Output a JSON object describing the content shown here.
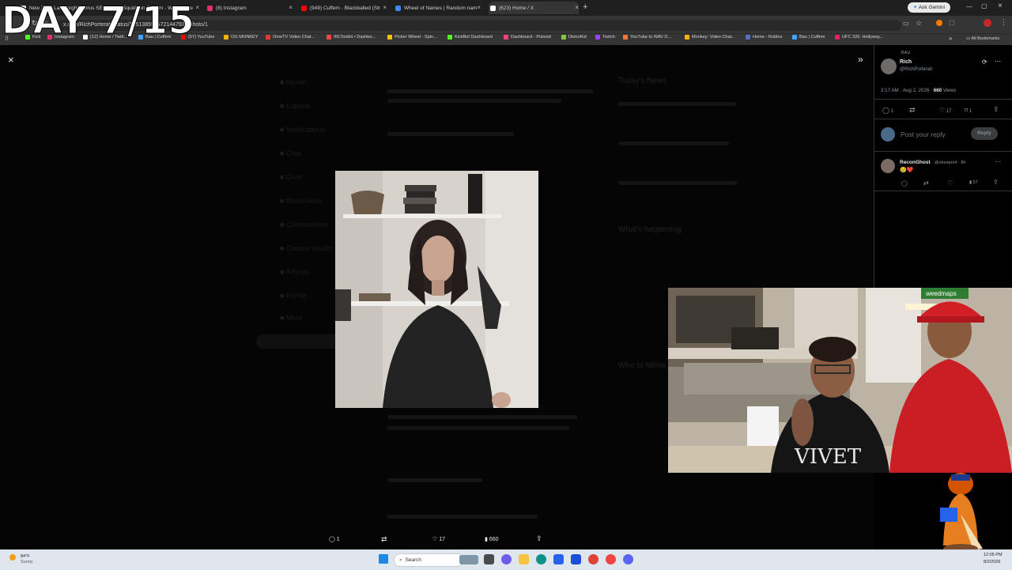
{
  "overlay": {
    "day_label": "DAY 7/15"
  },
  "tabs": [
    {
      "label": "New 2026 Lamborghini Urus SE",
      "color": "#e8e8e8"
    },
    {
      "label": "SquidRon Stream - Watch Live",
      "color": "#53fc18"
    },
    {
      "label": "(8) Instagram",
      "color": "#e1306c"
    },
    {
      "label": "(949) Cuffem - Blackballed (Str",
      "color": "#ff0000"
    },
    {
      "label": "Wheel of Names | Random nam",
      "color": "#4285f4"
    },
    {
      "label": "(623) Home / X",
      "color": "#ffffff"
    }
  ],
  "browser": {
    "url": "x.com/RichPorterati/status/1951385906721447936/photo/1",
    "ask_gemini": "Ask Gemini",
    "all_bookmarks": "All Bookmarks"
  },
  "bookmarks": [
    {
      "label": "Kick",
      "color": "#53fc18"
    },
    {
      "label": "Instagram",
      "color": "#e1306c"
    },
    {
      "label": "(12) Home / Twitt...",
      "color": "#ffffff"
    },
    {
      "label": "Bau | Cuffem",
      "color": "#3ea6ff"
    },
    {
      "label": "(57) YouTube",
      "color": "#ff0000"
    },
    {
      "label": "OG MONKEY",
      "color": "#f4b400"
    },
    {
      "label": "OmeTV Video Chat...",
      "color": "#e53935"
    },
    {
      "label": "IRLToolkit • Dashbo...",
      "color": "#ff4444"
    },
    {
      "label": "Picker Wheel - Spin...",
      "color": "#ffc107"
    },
    {
      "label": "KickBot Dashboard",
      "color": "#53fc18"
    },
    {
      "label": "Dashboard - Pulsoid",
      "color": "#ff4081"
    },
    {
      "label": "DistroKid",
      "color": "#8bc34a"
    },
    {
      "label": "Twitch",
      "color": "#9146ff"
    },
    {
      "label": "YouTube to WAV D...",
      "color": "#ff7043"
    },
    {
      "label": "Monkey: Video Chat...",
      "color": "#ffb300"
    },
    {
      "label": "Home - Roblox",
      "color": "#5c6bc0"
    },
    {
      "label": "Bau | Cuffem",
      "color": "#3ea6ff"
    },
    {
      "label": "UFC 326: Hollyway...",
      "color": "#e91e63"
    }
  ],
  "post_actions": {
    "replies": "1",
    "likes": "17",
    "views": "660"
  },
  "tweet": {
    "context": "BAU",
    "author_name": "Rich",
    "handle": "@RIchPorterati",
    "time": "3:17 AM · Aug 2, 2026 ·",
    "views_count": "660",
    "views_label": "Views",
    "replies": "1",
    "likes": "17",
    "bookmarks": "1"
  },
  "reply_box": {
    "placeholder": "Post your reply",
    "button": "Reply"
  },
  "reply": {
    "name": "ReconGhost",
    "handle": "@sheeprn4 · 8h",
    "text": "😢❤️",
    "views": "57"
  },
  "stream_overlay": {
    "shirt_text": "VIVET",
    "hat_text": "weedmaps"
  },
  "taskbar": {
    "temperature": "84°F",
    "weather": "Sunny",
    "search_placeholder": "Search",
    "time": "12:05 PM",
    "date": "8/2/2026"
  },
  "colors": {
    "x_bg": "#000000",
    "accent": "#1d9bf0",
    "taskbar": "#dfe6ee"
  }
}
